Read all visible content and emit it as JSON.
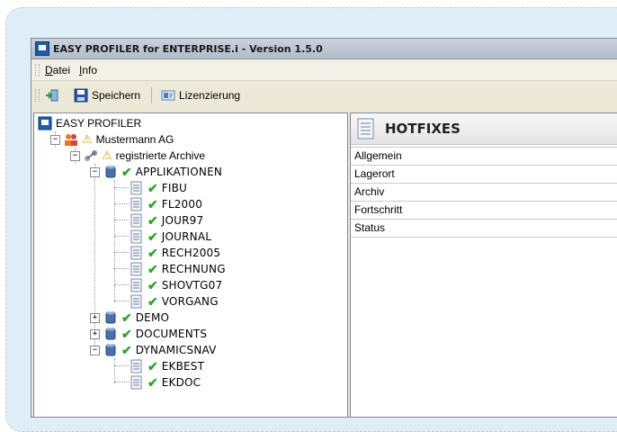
{
  "window": {
    "title": "EASY PROFILER for ENTERPRISE.i - Version 1.5.0"
  },
  "menu": [
    {
      "accel": "D",
      "rest": "atei"
    },
    {
      "accel": "I",
      "rest": "nfo"
    }
  ],
  "toolbar": {
    "save_label": "Speichern",
    "license_label": "Lizenzierung"
  },
  "tree": {
    "root": "EASY PROFILER",
    "company": "Mustermann AG",
    "archives": "registrierte Archive",
    "applikationen": "APPLIKATIONEN",
    "app_children": [
      "FIBU",
      "FL2000",
      "JOUR97",
      "JOURNAL",
      "RECH2005",
      "RECHNUNG",
      "SHOVTG07",
      "VORGANG"
    ],
    "demo": "DEMO",
    "documents": "DOCUMENTS",
    "dynamicsnav": "DYNAMICSNAV",
    "nav_children": [
      "EKBEST",
      "EKDOC"
    ]
  },
  "detail": {
    "title": "HOTFIXES",
    "properties": [
      "Allgemein",
      "Lagerort",
      "Archiv",
      "Fortschritt",
      "Status"
    ]
  },
  "colors": {
    "frame": "#dfeef6",
    "window": "#ece9d8",
    "check": "#2fa32f",
    "warning": "#d8a000"
  }
}
